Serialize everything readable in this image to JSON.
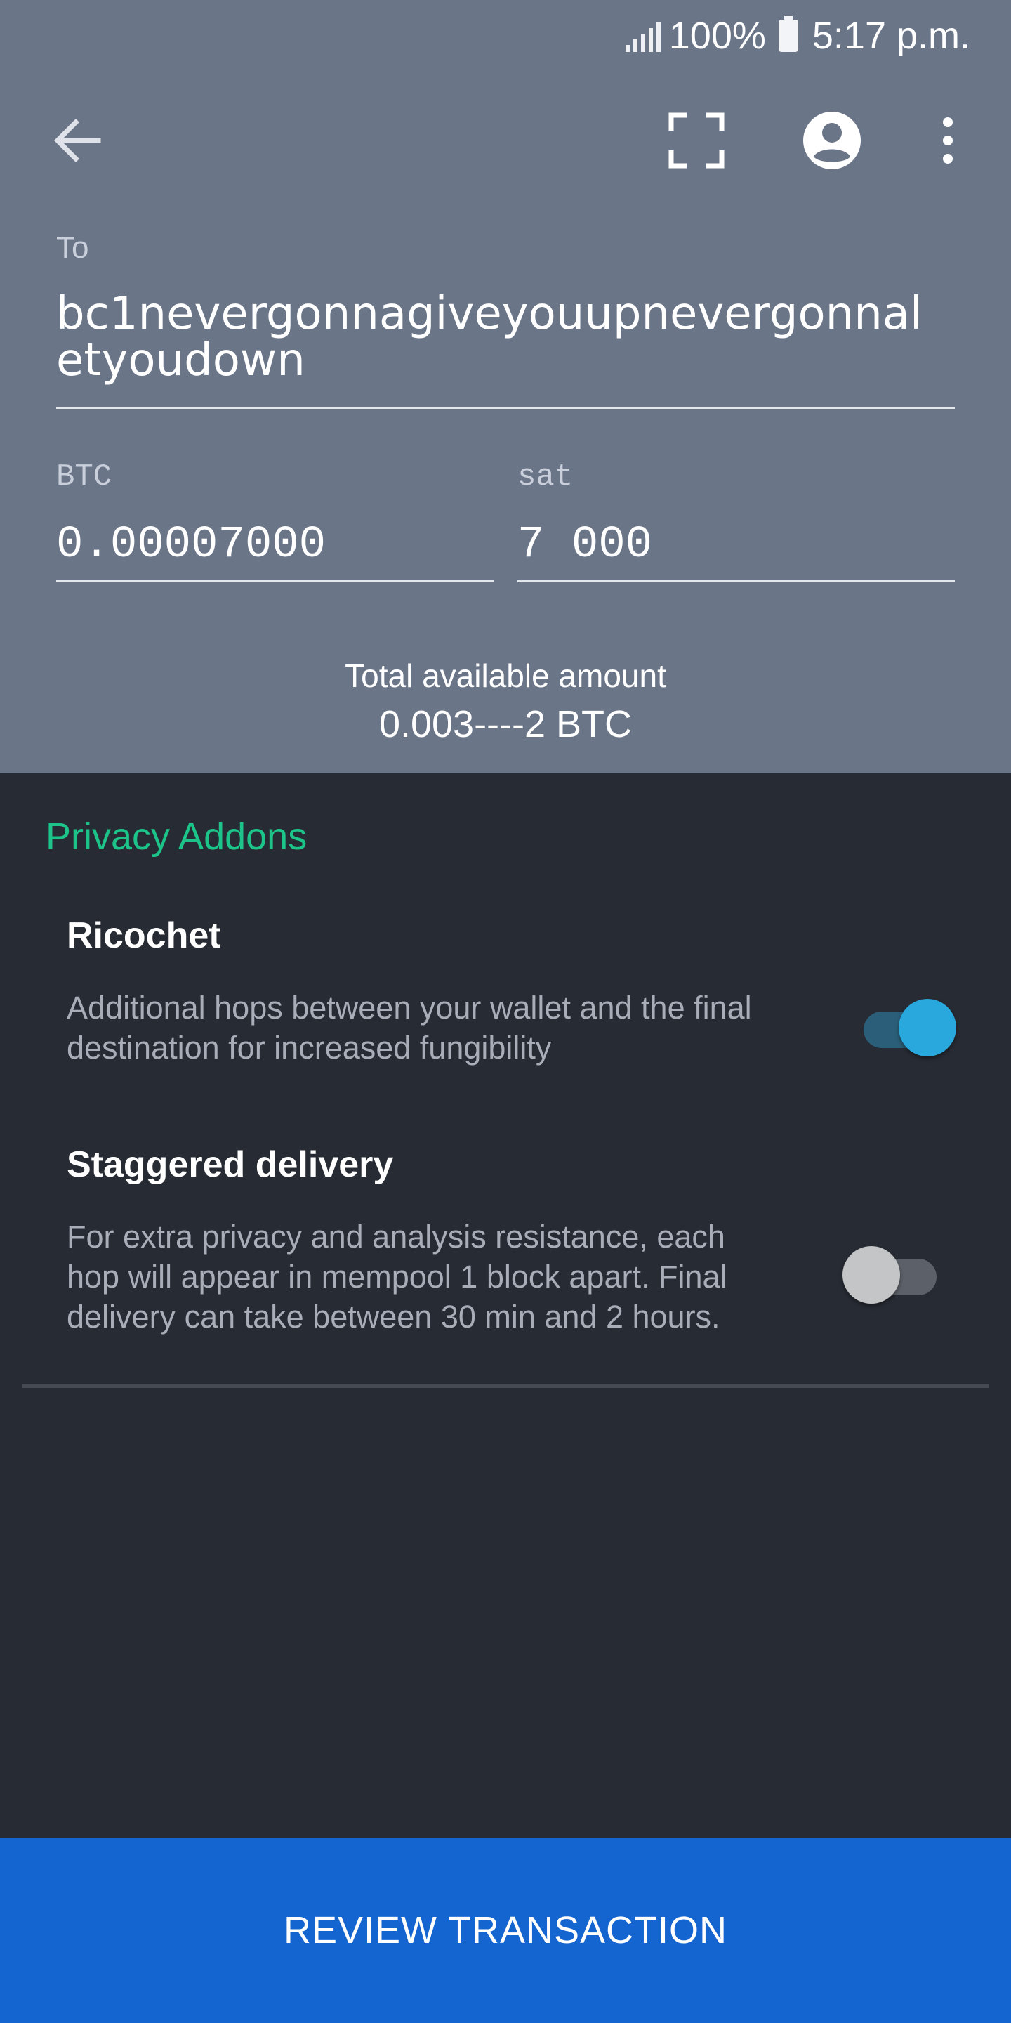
{
  "status_bar": {
    "battery_percent": "100%",
    "time": "5:17 p.m.",
    "icons": [
      "signal-icon",
      "battery-icon"
    ]
  },
  "toolbar": {
    "icons": [
      "back-arrow-icon",
      "scan-qr-icon",
      "account-circle-icon",
      "more-vert-icon"
    ]
  },
  "form": {
    "to_label": "To",
    "address": "bc1nevergonnagiveyouupnevergonnaletyoudown",
    "btc_label": "BTC",
    "btc_value": "0.00007000",
    "sat_label": "sat",
    "sat_value": "7 000"
  },
  "balance": {
    "label": "Total available amount",
    "value": "0.003----2 BTC"
  },
  "privacy": {
    "section_title": "Privacy Addons",
    "options": [
      {
        "title": "Ricochet",
        "description": "Additional hops between your wallet and the final destination for increased fungibility",
        "enabled": true
      },
      {
        "title": "Staggered delivery",
        "description": "For extra privacy and analysis resistance, each hop will appear in mempool 1 block apart. Final delivery can take between 30 min and 2 hours.",
        "enabled": false
      }
    ]
  },
  "review_button": "REVIEW TRANSACTION",
  "colors": {
    "header_bg": "#6b7588",
    "body_bg": "#272b33",
    "accent_green": "#1cc48a",
    "toggle_on": "#29a8dd",
    "button_bg": "#1565d0"
  }
}
